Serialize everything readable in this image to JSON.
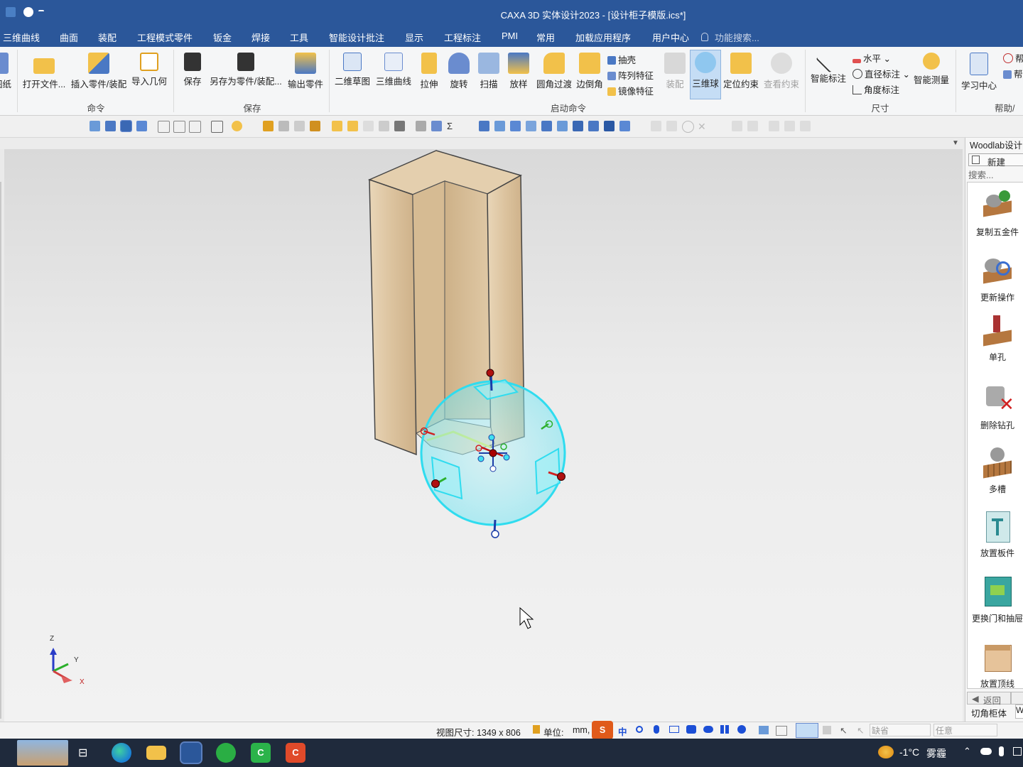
{
  "window": {
    "title": "CAXA 3D 实体设计2023 - [设计柜子模版.ics*]"
  },
  "menu": {
    "tabs": [
      "三维曲线",
      "曲面",
      "装配",
      "工程模式零件",
      "钣金",
      "焊接",
      "工具",
      "智能设计批注",
      "显示",
      "工程标注",
      "PMI",
      "常用",
      "加载应用程序",
      "用户中心"
    ],
    "search_placeholder": "功能搜索..."
  },
  "ribbon": {
    "cut_label": "图纸",
    "open_file": "打开文件...",
    "insert_part": "插入零件/装配",
    "import_geometry": "导入几何",
    "group_command": "命令",
    "save": "保存",
    "save_as": "另存为零件/装配...",
    "export_part": "输出零件",
    "group_save": "保存",
    "sketch_2d": "二维草图",
    "curve_3d": "三维曲线",
    "extrude": "拉伸",
    "revolve": "旋转",
    "sweep": "扫描",
    "loft": "放样",
    "fillet": "圆角过渡",
    "chamfer": "边倒角",
    "shell": "抽壳",
    "pattern": "阵列特征",
    "mirror": "镜像特征",
    "assemble": "装配",
    "triball": "三维球",
    "position_constraint": "定位约束",
    "view_constraint": "查看约束",
    "group_start": "启动命令",
    "smart_dimension": "智能标注",
    "horizontal": "水平",
    "diameter_dim": "直径标注",
    "angle_dim": "角度标注",
    "group_dimension": "尺寸",
    "smart_measure": "智能测量",
    "learning_center": "学习中心",
    "help_1": "帮",
    "help_2": "帮",
    "group_help": "帮助/"
  },
  "panel": {
    "title": "Woodlab设计",
    "new_button": "新建",
    "search_placeholder": "搜索...",
    "items": [
      "复制五金件",
      "更新操作",
      "单孔",
      "删除钻孔",
      "多槽",
      "放置板件",
      "更换门和抽屉",
      "放置顶线"
    ],
    "back_button": "返回",
    "tab_label": "切角柜体",
    "tab_value": "W"
  },
  "axes": {
    "z": "Z",
    "y": "Y",
    "x": "X"
  },
  "status": {
    "view_size": "视图尺寸: 1349 x  806",
    "unit_label": "单位:",
    "unit_value": "mm,",
    "ime_lang": "中",
    "combo_default": "缺省",
    "combo_any": "任意"
  },
  "taskbar": {
    "weather_temp": "-1°C",
    "weather_desc": "雾霾"
  },
  "colors": {
    "titlebar": "#2b579a",
    "wood": "#dcc3a0",
    "triball": "#3fe0f0"
  }
}
